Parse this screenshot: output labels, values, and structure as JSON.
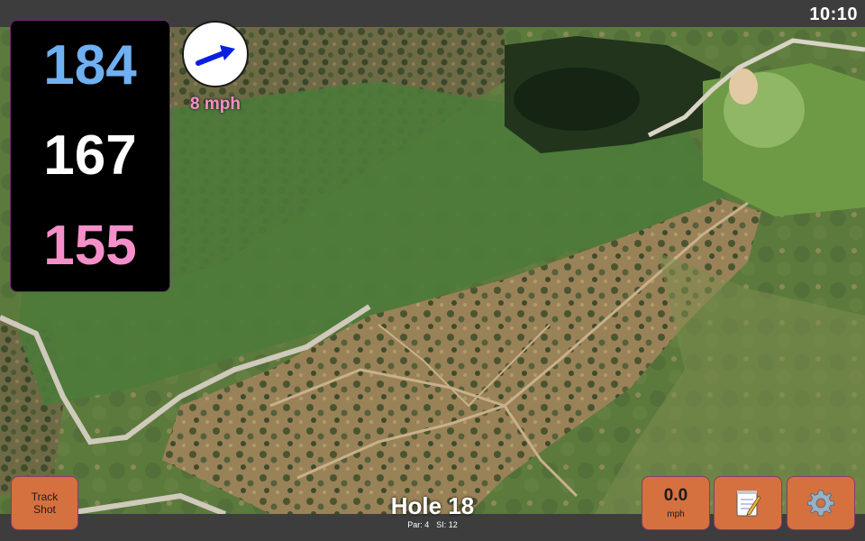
{
  "status_bar": {
    "time": "10:10"
  },
  "yardages": {
    "back": "184",
    "middle": "167",
    "front": "155"
  },
  "wind": {
    "speed_text": "8 mph",
    "direction_icon": "arrow-icon"
  },
  "buttons": {
    "track_shot": {
      "line1": "Track",
      "line2": "Shot"
    },
    "speed": {
      "value": "0.0",
      "unit": "mph"
    },
    "notes": {
      "icon": "notepad-icon"
    },
    "settings": {
      "icon": "gear-icon"
    }
  },
  "hole": {
    "title": "Hole 18",
    "par": "Par: 4",
    "si": "SI: 12"
  },
  "colors": {
    "back_yardage": "#6fb0f2",
    "middle_yardage": "#ffffff",
    "front_yardage": "#f58fc9",
    "button_orange": "#d4713f",
    "fairway_green": "#4d7a3a",
    "scrub": "#6b6b3a"
  }
}
